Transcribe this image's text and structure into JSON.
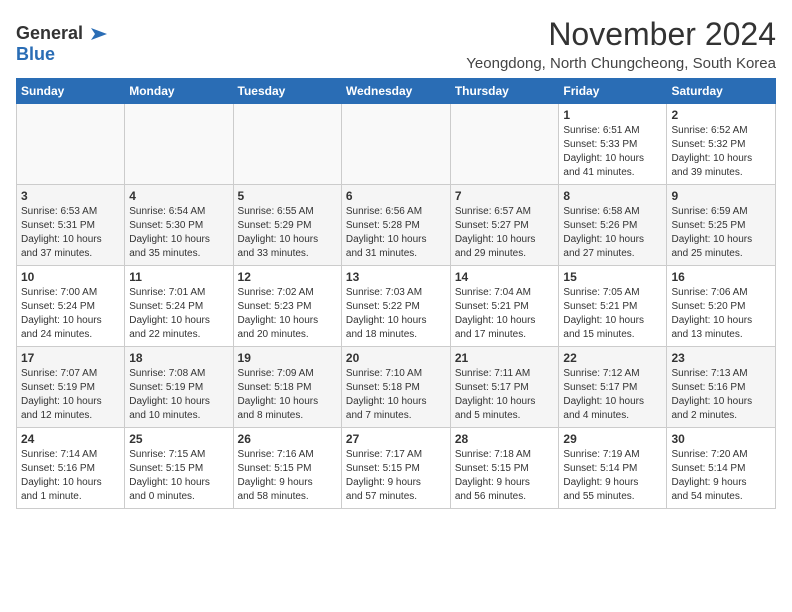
{
  "header": {
    "logo": {
      "line1": "General",
      "line2": "Blue"
    },
    "month": "November 2024",
    "location": "Yeongdong, North Chungcheong, South Korea"
  },
  "weekdays": [
    "Sunday",
    "Monday",
    "Tuesday",
    "Wednesday",
    "Thursday",
    "Friday",
    "Saturday"
  ],
  "weeks": [
    [
      {
        "day": "",
        "info": ""
      },
      {
        "day": "",
        "info": ""
      },
      {
        "day": "",
        "info": ""
      },
      {
        "day": "",
        "info": ""
      },
      {
        "day": "",
        "info": ""
      },
      {
        "day": "1",
        "info": "Sunrise: 6:51 AM\nSunset: 5:33 PM\nDaylight: 10 hours\nand 41 minutes."
      },
      {
        "day": "2",
        "info": "Sunrise: 6:52 AM\nSunset: 5:32 PM\nDaylight: 10 hours\nand 39 minutes."
      }
    ],
    [
      {
        "day": "3",
        "info": "Sunrise: 6:53 AM\nSunset: 5:31 PM\nDaylight: 10 hours\nand 37 minutes."
      },
      {
        "day": "4",
        "info": "Sunrise: 6:54 AM\nSunset: 5:30 PM\nDaylight: 10 hours\nand 35 minutes."
      },
      {
        "day": "5",
        "info": "Sunrise: 6:55 AM\nSunset: 5:29 PM\nDaylight: 10 hours\nand 33 minutes."
      },
      {
        "day": "6",
        "info": "Sunrise: 6:56 AM\nSunset: 5:28 PM\nDaylight: 10 hours\nand 31 minutes."
      },
      {
        "day": "7",
        "info": "Sunrise: 6:57 AM\nSunset: 5:27 PM\nDaylight: 10 hours\nand 29 minutes."
      },
      {
        "day": "8",
        "info": "Sunrise: 6:58 AM\nSunset: 5:26 PM\nDaylight: 10 hours\nand 27 minutes."
      },
      {
        "day": "9",
        "info": "Sunrise: 6:59 AM\nSunset: 5:25 PM\nDaylight: 10 hours\nand 25 minutes."
      }
    ],
    [
      {
        "day": "10",
        "info": "Sunrise: 7:00 AM\nSunset: 5:24 PM\nDaylight: 10 hours\nand 24 minutes."
      },
      {
        "day": "11",
        "info": "Sunrise: 7:01 AM\nSunset: 5:24 PM\nDaylight: 10 hours\nand 22 minutes."
      },
      {
        "day": "12",
        "info": "Sunrise: 7:02 AM\nSunset: 5:23 PM\nDaylight: 10 hours\nand 20 minutes."
      },
      {
        "day": "13",
        "info": "Sunrise: 7:03 AM\nSunset: 5:22 PM\nDaylight: 10 hours\nand 18 minutes."
      },
      {
        "day": "14",
        "info": "Sunrise: 7:04 AM\nSunset: 5:21 PM\nDaylight: 10 hours\nand 17 minutes."
      },
      {
        "day": "15",
        "info": "Sunrise: 7:05 AM\nSunset: 5:21 PM\nDaylight: 10 hours\nand 15 minutes."
      },
      {
        "day": "16",
        "info": "Sunrise: 7:06 AM\nSunset: 5:20 PM\nDaylight: 10 hours\nand 13 minutes."
      }
    ],
    [
      {
        "day": "17",
        "info": "Sunrise: 7:07 AM\nSunset: 5:19 PM\nDaylight: 10 hours\nand 12 minutes."
      },
      {
        "day": "18",
        "info": "Sunrise: 7:08 AM\nSunset: 5:19 PM\nDaylight: 10 hours\nand 10 minutes."
      },
      {
        "day": "19",
        "info": "Sunrise: 7:09 AM\nSunset: 5:18 PM\nDaylight: 10 hours\nand 8 minutes."
      },
      {
        "day": "20",
        "info": "Sunrise: 7:10 AM\nSunset: 5:18 PM\nDaylight: 10 hours\nand 7 minutes."
      },
      {
        "day": "21",
        "info": "Sunrise: 7:11 AM\nSunset: 5:17 PM\nDaylight: 10 hours\nand 5 minutes."
      },
      {
        "day": "22",
        "info": "Sunrise: 7:12 AM\nSunset: 5:17 PM\nDaylight: 10 hours\nand 4 minutes."
      },
      {
        "day": "23",
        "info": "Sunrise: 7:13 AM\nSunset: 5:16 PM\nDaylight: 10 hours\nand 2 minutes."
      }
    ],
    [
      {
        "day": "24",
        "info": "Sunrise: 7:14 AM\nSunset: 5:16 PM\nDaylight: 10 hours\nand 1 minute."
      },
      {
        "day": "25",
        "info": "Sunrise: 7:15 AM\nSunset: 5:15 PM\nDaylight: 10 hours\nand 0 minutes."
      },
      {
        "day": "26",
        "info": "Sunrise: 7:16 AM\nSunset: 5:15 PM\nDaylight: 9 hours\nand 58 minutes."
      },
      {
        "day": "27",
        "info": "Sunrise: 7:17 AM\nSunset: 5:15 PM\nDaylight: 9 hours\nand 57 minutes."
      },
      {
        "day": "28",
        "info": "Sunrise: 7:18 AM\nSunset: 5:15 PM\nDaylight: 9 hours\nand 56 minutes."
      },
      {
        "day": "29",
        "info": "Sunrise: 7:19 AM\nSunset: 5:14 PM\nDaylight: 9 hours\nand 55 minutes."
      },
      {
        "day": "30",
        "info": "Sunrise: 7:20 AM\nSunset: 5:14 PM\nDaylight: 9 hours\nand 54 minutes."
      }
    ]
  ]
}
